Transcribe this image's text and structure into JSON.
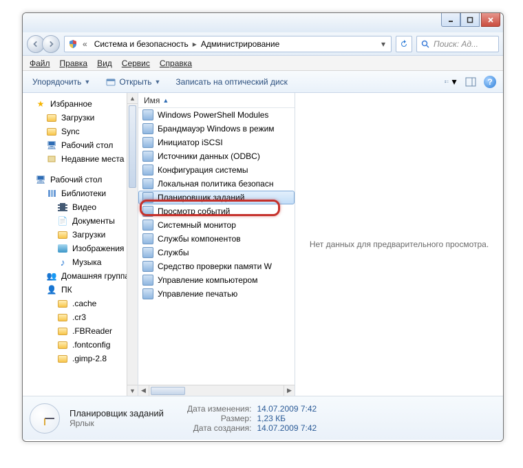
{
  "breadcrumb": {
    "seg1": "Система и безопасность",
    "seg2": "Администрирование"
  },
  "search": {
    "placeholder": "Поиск: Ад..."
  },
  "menubar": {
    "file": "Файл",
    "edit": "Правка",
    "view": "Вид",
    "tools": "Сервис",
    "help": "Справка"
  },
  "toolbar": {
    "organize": "Упорядочить",
    "open": "Открыть",
    "burn": "Записать на оптический диск"
  },
  "sidebar": {
    "favorites": "Избранное",
    "downloads": "Загрузки",
    "sync": "Sync",
    "desktop": "Рабочий стол",
    "recent": "Недавние места",
    "desktop2": "Рабочий стол",
    "libraries": "Библиотеки",
    "videos": "Видео",
    "documents": "Документы",
    "downloads2": "Загрузки",
    "pictures": "Изображения",
    "music": "Музыка",
    "homegroup": "Домашняя группа",
    "pc": "ПК",
    "cache": ".cache",
    "cr3": ".cr3",
    "fbreader": ".FBReader",
    "fontconfig": ".fontconfig",
    "gimp": ".gimp-2.8"
  },
  "column": {
    "name": "Имя"
  },
  "files": {
    "f0": "Windows PowerShell Modules",
    "f1": "Брандмауэр Windows в режим",
    "f2": "Инициатор iSCSI",
    "f3": "Источники данных (ODBC)",
    "f4": "Конфигурация системы",
    "f5": "Локальная политика безопасн",
    "f6": "Планировщик заданий",
    "f7": "Просмотр событий",
    "f8": "Системный монитор",
    "f9": "Службы компонентов",
    "f10": "Службы",
    "f11": "Средство проверки памяти W",
    "f12": "Управление компьютером",
    "f13": "Управление печатью"
  },
  "preview": {
    "empty": "Нет данных для предварительного просмотра."
  },
  "details": {
    "title": "Планировщик заданий",
    "type": "Ярлык",
    "labels": {
      "modified": "Дата изменения:",
      "size": "Размер:",
      "created": "Дата создания:"
    },
    "values": {
      "modified": "14.07.2009 7:42",
      "size": "1,23 КБ",
      "created": "14.07.2009 7:42"
    }
  }
}
